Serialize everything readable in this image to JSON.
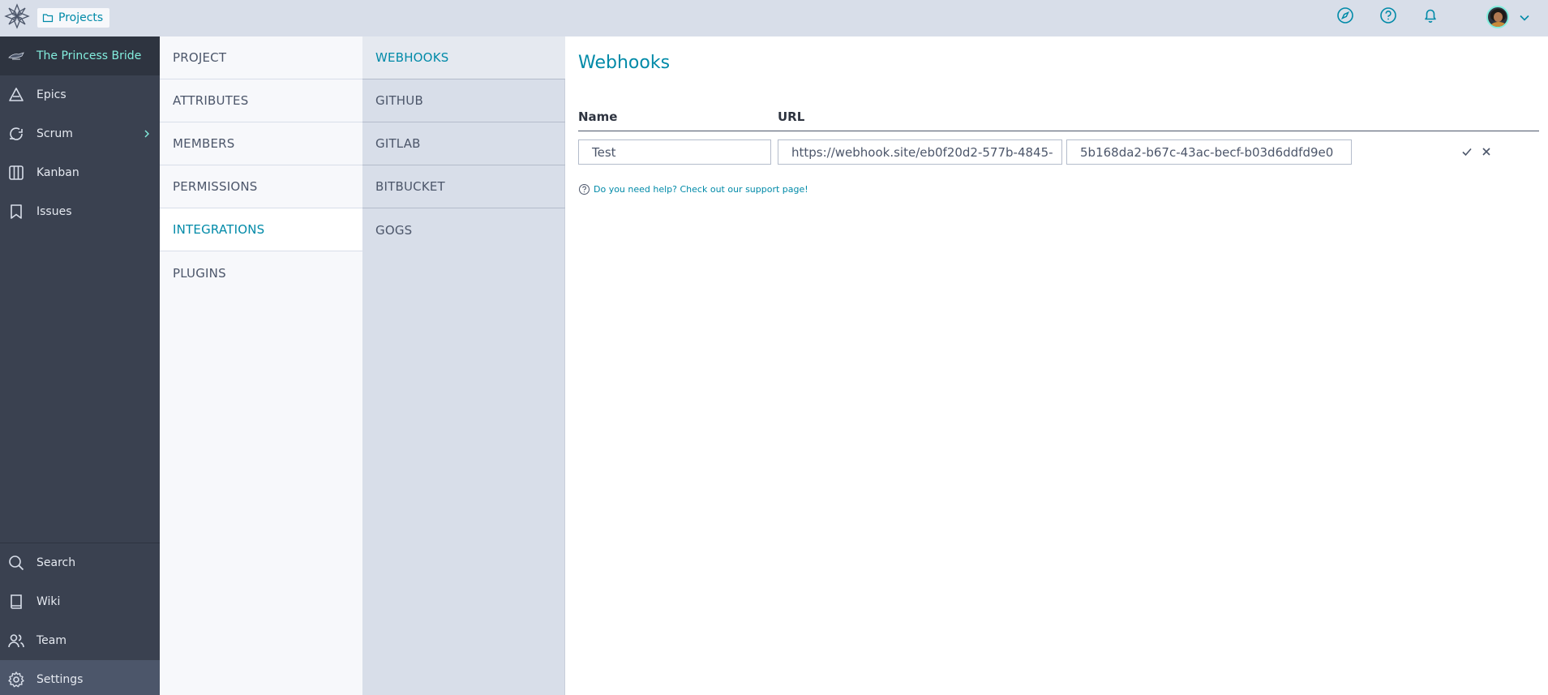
{
  "topbar": {
    "projects_label": "Projects",
    "icons": [
      "discover-icon",
      "help-icon",
      "notifications-icon"
    ]
  },
  "sidebar": {
    "project_name": "The Princess Bride",
    "items": [
      {
        "label": "Epics",
        "icon": "epics-icon"
      },
      {
        "label": "Scrum",
        "icon": "scrum-icon"
      },
      {
        "label": "Kanban",
        "icon": "kanban-icon"
      },
      {
        "label": "Issues",
        "icon": "issues-icon"
      }
    ],
    "bottom_items": [
      {
        "label": "Search",
        "icon": "search-icon"
      },
      {
        "label": "Wiki",
        "icon": "wiki-icon"
      },
      {
        "label": "Team",
        "icon": "team-icon"
      },
      {
        "label": "Settings",
        "icon": "settings-icon",
        "active": true
      }
    ]
  },
  "settings_menu": {
    "items": [
      {
        "label": "PROJECT"
      },
      {
        "label": "ATTRIBUTES"
      },
      {
        "label": "MEMBERS"
      },
      {
        "label": "PERMISSIONS"
      },
      {
        "label": "INTEGRATIONS",
        "active": true
      },
      {
        "label": "PLUGINS"
      }
    ]
  },
  "integrations_menu": {
    "items": [
      {
        "label": "WEBHOOKS",
        "active": true
      },
      {
        "label": "GITHUB"
      },
      {
        "label": "GITLAB"
      },
      {
        "label": "BITBUCKET"
      },
      {
        "label": "GOGS"
      }
    ]
  },
  "main": {
    "title": "Webhooks",
    "columns": {
      "name": "Name",
      "url": "URL"
    },
    "form": {
      "name_value": "Test",
      "url_value": "https://webhook.site/eb0f20d2-577b-4845-",
      "key_value": "5b168da2-b67c-43ac-becf-b03d6ddfd9e0"
    },
    "help_text": "Do you need help? Check out our support page!"
  },
  "colors": {
    "accent": "#008aa8",
    "sidebar_bg": "#3a4150",
    "topbar_bg": "#d8dee9",
    "project_name": "#83eede"
  }
}
